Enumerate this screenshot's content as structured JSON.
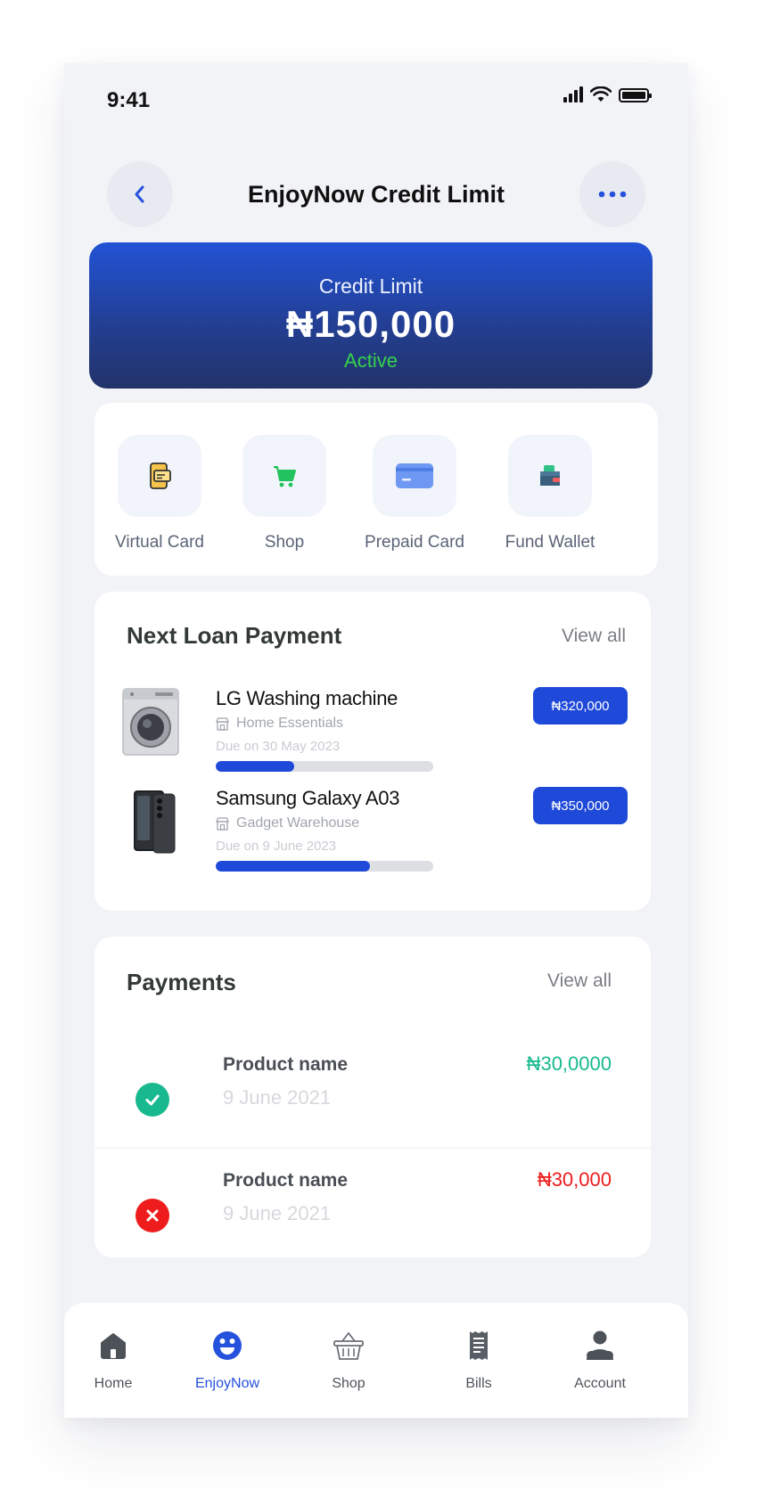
{
  "status_bar": {
    "time": "9:41"
  },
  "header": {
    "title": "EnjoyNow Credit Limit"
  },
  "credit": {
    "label": "Credit Limit",
    "amount": "₦150,000",
    "status": "Active"
  },
  "quick_actions": [
    {
      "label": "Virtual Card",
      "icon": "virtual-card-icon"
    },
    {
      "label": "Shop",
      "icon": "cart-icon"
    },
    {
      "label": "Prepaid Card",
      "icon": "credit-card-icon"
    },
    {
      "label": "Fund Wallet",
      "icon": "wallet-icon"
    }
  ],
  "loans": {
    "title": "Next Loan Payment",
    "view_all": "View all",
    "items": [
      {
        "name": "LG Washing machine",
        "store": "Home Essentials",
        "due": "Due on 30 May 2023",
        "price": "₦320,000",
        "progress": 0.36
      },
      {
        "name": "Samsung Galaxy A03",
        "store": "Gadget Warehouse",
        "due": "Due on 9 June 2023",
        "price": "₦350,000",
        "progress": 0.71
      }
    ]
  },
  "payments": {
    "title": "Payments",
    "view_all": "View all",
    "items": [
      {
        "name": "Product name",
        "date": "9 June 2021",
        "amount": "₦30,0000",
        "status": "success",
        "color": "#18b98f"
      },
      {
        "name": "Product name",
        "date": "9 June 2021",
        "amount": "₦30,000",
        "status": "failed",
        "color": "#ee1c1c"
      }
    ]
  },
  "nav": {
    "active": "EnjoyNow",
    "items": [
      {
        "label": "Home",
        "icon": "home-icon"
      },
      {
        "label": "EnjoyNow",
        "icon": "smiley-icon"
      },
      {
        "label": "Shop",
        "icon": "basket-icon"
      },
      {
        "label": "Bills",
        "icon": "receipt-icon"
      },
      {
        "label": "Account",
        "icon": "user-icon"
      }
    ]
  },
  "colors": {
    "primary": "#1f49d8",
    "success": "#18b98f",
    "danger": "#ee1c1c",
    "active_green": "#35d24a"
  }
}
